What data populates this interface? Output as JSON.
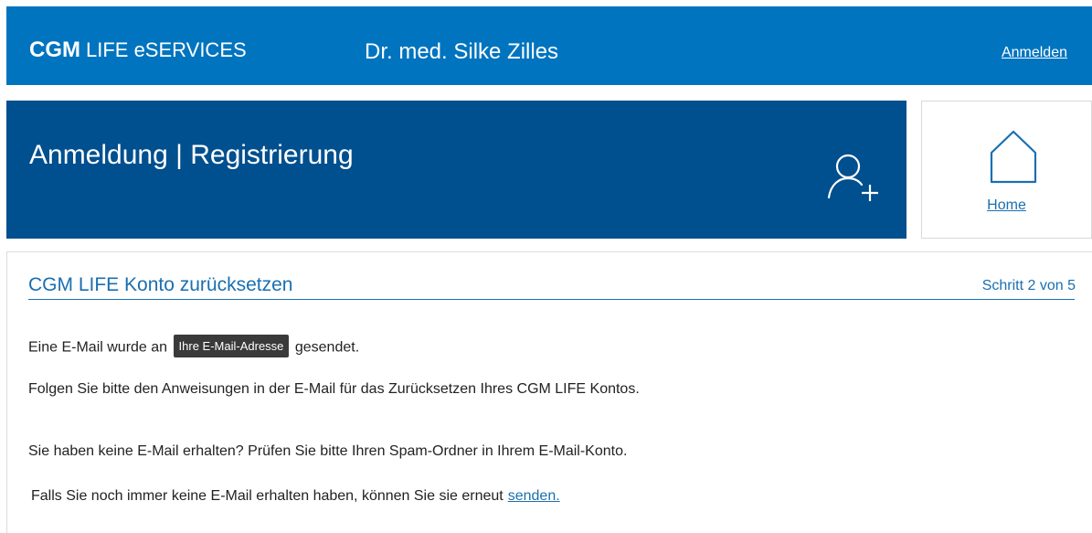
{
  "header": {
    "brand_strong": "CGM",
    "brand_light": "LIFE eSERVICES",
    "doctor_name": "Dr. med. Silke Zilles",
    "login_label": "Anmelden",
    "background_color": "#0074bf"
  },
  "banner": {
    "title": "Anmeldung | Registrierung",
    "icon": "user-add-icon",
    "background_color": "#004f8e"
  },
  "home_tile": {
    "label": "Home",
    "icon": "home-icon"
  },
  "content": {
    "title": "CGM LIFE Konto zurücksetzen",
    "step": "Schritt 2 von 5",
    "line1_prefix": "Eine E-Mail wurde an",
    "email_placeholder": "Ihre E-Mail-Adresse",
    "line1_suffix": "gesendet.",
    "line2": "Folgen Sie bitte den Anweisungen in der E-Mail für das Zurücksetzen Ihres CGM LIFE Kontos.",
    "line3": "Sie haben keine E-Mail erhalten? Prüfen Sie bitte Ihren Spam-Ordner in Ihrem E-Mail-Konto.",
    "line4_prefix": "Falls Sie noch immer keine E-Mail erhalten haben, können Sie sie erneut",
    "resend_label": "senden.",
    "accent_color": "#1a6fb0"
  }
}
